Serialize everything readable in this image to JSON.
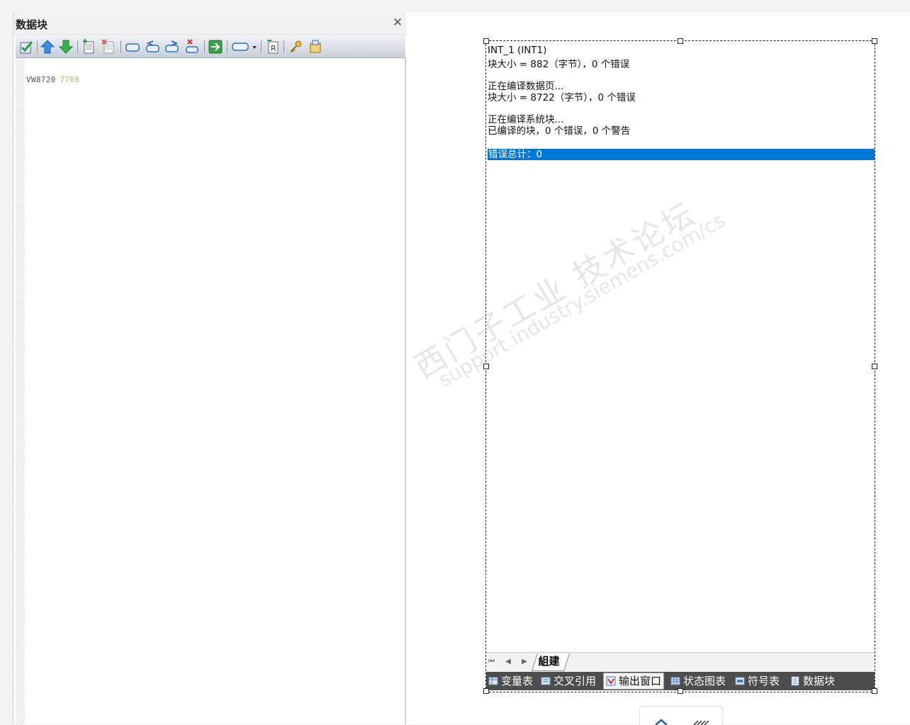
{
  "left_panel": {
    "title": "数据块",
    "close_glyph": "✕",
    "toolbar_icons": [
      "compile-check-icon",
      "arrow-up-icon",
      "arrow-down-icon",
      "insert-page-icon",
      "delete-page-icon",
      "toggle-bookmark-icon",
      "prev-bookmark-icon",
      "next-bookmark-icon",
      "clear-bookmarks-icon",
      "goto-icon",
      "tag-dropdown-icon",
      "properties-icon",
      "key-icon",
      "library-icon"
    ],
    "code": {
      "address": "VW8720",
      "value": "7708"
    }
  },
  "output_window": {
    "lines": [
      "INT_1 (INT1)",
      "块大小 = 882（字节），0 个错误",
      "正在编译数据页...",
      "块大小 = 8722（字节），0 个错误",
      "正在编译系统块...",
      "已编译的块，0 个错误，0 个警告"
    ],
    "error_total": "错误总计：0",
    "sheet_tab": "組建",
    "nav_arrows": "⏮ ◀ ▶ ⏭",
    "taskbar": [
      {
        "label": "变量表",
        "icon": "variable-table-icon"
      },
      {
        "label": "交叉引用",
        "icon": "cross-reference-icon"
      },
      {
        "label": "输出窗口",
        "icon": "output-window-icon",
        "active": true
      },
      {
        "label": "状态图表",
        "icon": "status-chart-icon"
      },
      {
        "label": "符号表",
        "icon": "symbol-table-icon"
      },
      {
        "label": "数据块",
        "icon": "data-block-icon"
      }
    ]
  },
  "watermark": {
    "cn": "西门子工业  技术论坛",
    "url": "support.industry.siemens.com/cs"
  },
  "colors": {
    "selection": "#0078d7",
    "taskbar": "#4d4d4d",
    "code_value": "#b5b56a"
  }
}
